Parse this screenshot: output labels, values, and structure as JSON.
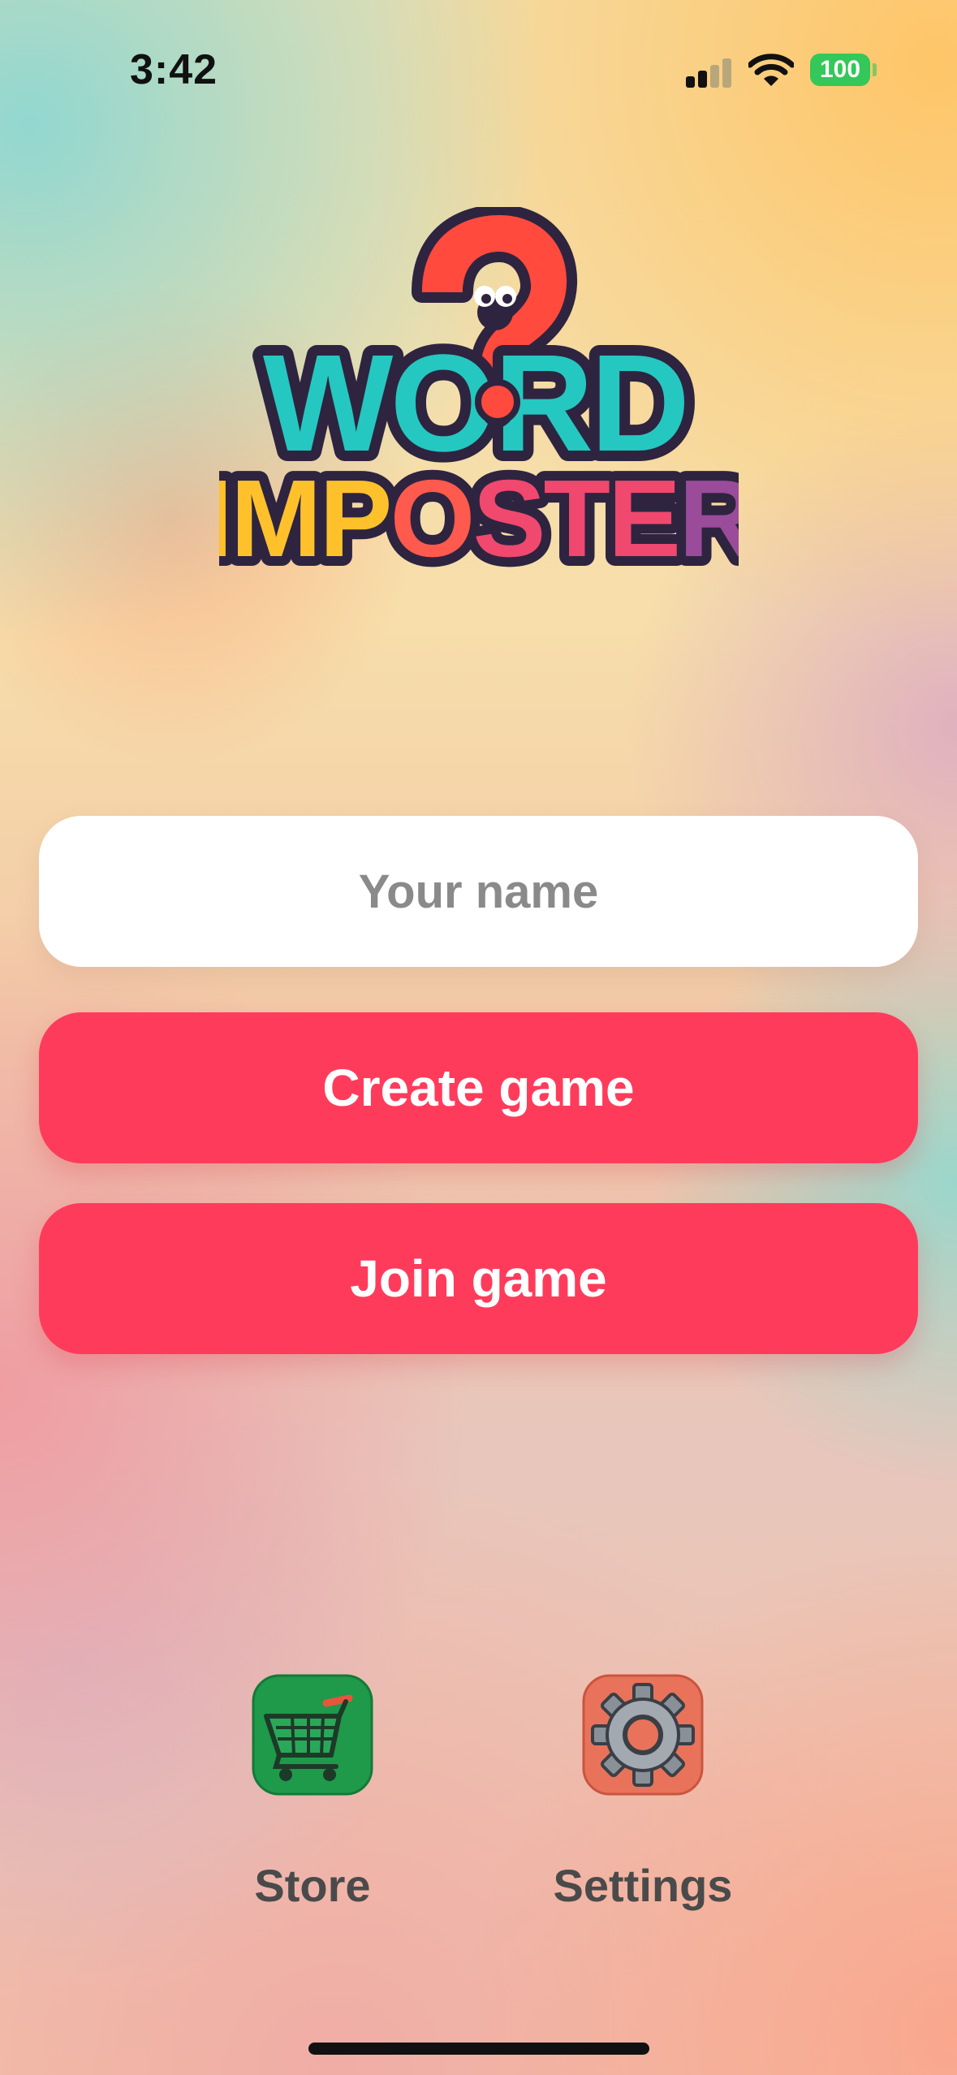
{
  "status_bar": {
    "time": "3:42",
    "battery": "100",
    "battery_color": "#34c759"
  },
  "logo": {
    "line1": "WORD",
    "line2": "IMPOSTER"
  },
  "form": {
    "name_placeholder": "Your name",
    "name_value": ""
  },
  "buttons": {
    "create_label": "Create game",
    "join_label": "Join game",
    "accent_color": "#ff3b5c"
  },
  "nav": {
    "store_label": "Store",
    "store_icon": "shopping-cart-icon",
    "settings_label": "Settings",
    "settings_icon": "gear-icon"
  }
}
